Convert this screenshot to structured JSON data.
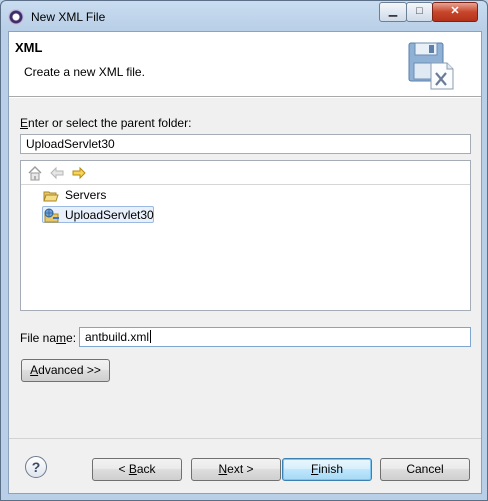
{
  "window": {
    "title": "New XML File",
    "minimize_glyph": "▁",
    "maximize_glyph": "□",
    "close_glyph": "✕"
  },
  "header": {
    "title": "XML",
    "description": "Create a new XML file."
  },
  "parent_folder": {
    "label_mnemonic": "E",
    "label_rest": "nter or select the parent folder:",
    "value": "UploadServlet30"
  },
  "tree": {
    "items": [
      {
        "label": "Servers",
        "icon": "folder-open-icon",
        "selected": false
      },
      {
        "label": "UploadServlet30",
        "icon": "web-project-icon",
        "selected": true
      }
    ]
  },
  "file_name": {
    "label_before": "File na",
    "label_mnemonic": "m",
    "label_after": "e:",
    "value": "antbuild.xml"
  },
  "buttons": {
    "advanced_mnemonic": "A",
    "advanced_rest": "dvanced >>",
    "back_before": "< ",
    "back_mnemonic": "B",
    "back_after": "ack",
    "next_mnemonic": "N",
    "next_after": "ext >",
    "finish_mnemonic": "F",
    "finish_after": "inish",
    "cancel": "Cancel",
    "help_glyph": "?"
  }
}
